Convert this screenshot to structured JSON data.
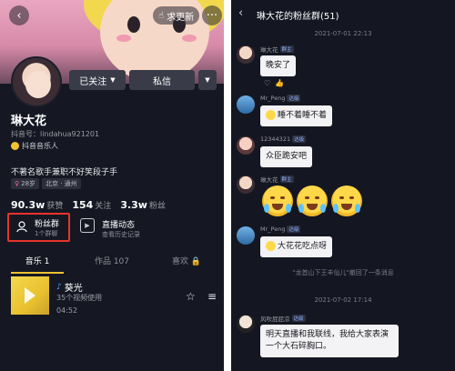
{
  "profile": {
    "follow_pill": "求更新",
    "followed_button": "已关注",
    "message_button": "私信",
    "name": "琳大花",
    "douyin_id": "抖音号：lindahua921201",
    "musician_label": "抖音音乐人",
    "bio": "不著名歌手兼职不好笑段子手",
    "tags": [
      "28岁",
      "北京 · 通州"
    ],
    "stats": [
      {
        "num": "90.3w",
        "label": "获赞"
      },
      {
        "num": "154",
        "label": "关注"
      },
      {
        "num": "3.3w",
        "label": "粉丝"
      }
    ],
    "fan_group": {
      "title": "粉丝群",
      "sub": "1个群聊"
    },
    "live": {
      "title": "直播动态",
      "sub": "查看历史记录"
    },
    "tabs": [
      "音乐 1",
      "作品 107",
      "喜欢"
    ],
    "song": {
      "title": "葵光",
      "uses": "35个视频使用",
      "duration": "04:52"
    }
  },
  "chat": {
    "title": "琳大花的粉丝群(51)",
    "timestamps": [
      "2021-07-01 22:13",
      "2021-07-02 17:14"
    ],
    "messages": [
      {
        "sender": "琳大花",
        "badge": "群主",
        "text": "晚安了"
      },
      {
        "sender": "Mr_Peng",
        "badge": "达级",
        "text": "睡不着睡不着"
      },
      {
        "sender": "12344321",
        "badge": "达级",
        "text": "众臣跪安吧"
      },
      {
        "sender": "琳大花",
        "badge": "群主",
        "text": ""
      },
      {
        "sender": "Mr_Peng",
        "badge": "达级",
        "text": "大花花吃点呀"
      },
      {
        "sender": "风吹屁屁凉",
        "badge": "达级",
        "text": "明天直播和我联线，我给大家表演一个大石碎胸口。"
      }
    ],
    "system_note": "\"龙首山下王丰仙儿\"撤回了一条消息"
  },
  "colors": {
    "accent_yellow": "#f2c230",
    "highlight_red": "#e8332c",
    "bg_dark": "#151823"
  }
}
